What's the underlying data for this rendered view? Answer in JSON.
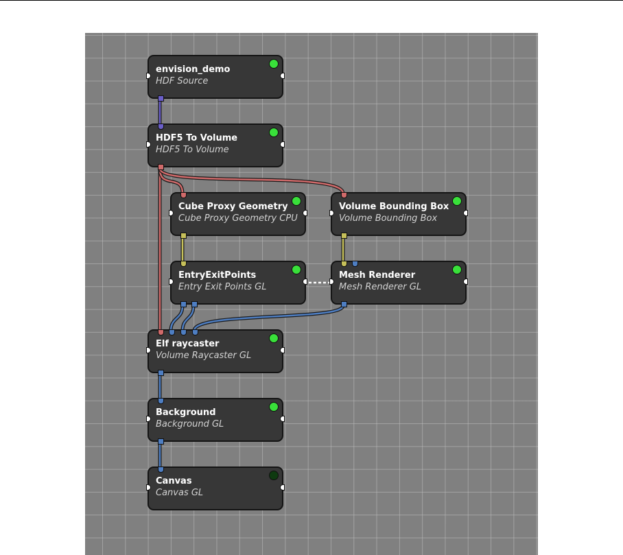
{
  "colors": {
    "volume": "#d06a6a",
    "mesh": "#c6c05a",
    "image": "#4e7ec2",
    "source": "#6a5ec8",
    "active_status": "#39e03a",
    "inactive_status": "#0e3a10",
    "node_bg": "#373737",
    "canvas_bg": "#808080"
  },
  "nodes": [
    {
      "id": "envision_demo",
      "title": "envision_demo",
      "subtitle": "HDF Source",
      "status": "active"
    },
    {
      "id": "hdf5_to_volume",
      "title": "HDF5 To Volume",
      "subtitle": "HDF5 To Volume",
      "status": "active"
    },
    {
      "id": "cube_proxy",
      "title": "Cube Proxy Geometry",
      "subtitle": "Cube Proxy Geometry CPU",
      "status": "active"
    },
    {
      "id": "volume_bbox",
      "title": "Volume Bounding Box",
      "subtitle": "Volume Bounding Box",
      "status": "active"
    },
    {
      "id": "entry_exit",
      "title": "EntryExitPoints",
      "subtitle": "Entry Exit Points GL",
      "status": "active"
    },
    {
      "id": "mesh_renderer",
      "title": "Mesh Renderer",
      "subtitle": "Mesh Renderer GL",
      "status": "active"
    },
    {
      "id": "raycaster",
      "title": "Elf raycaster",
      "subtitle": "Volume Raycaster GL",
      "status": "active"
    },
    {
      "id": "background",
      "title": "Background",
      "subtitle": "Background GL",
      "status": "active"
    },
    {
      "id": "canvas",
      "title": "Canvas",
      "subtitle": "Canvas GL",
      "status": "inactive"
    }
  ]
}
